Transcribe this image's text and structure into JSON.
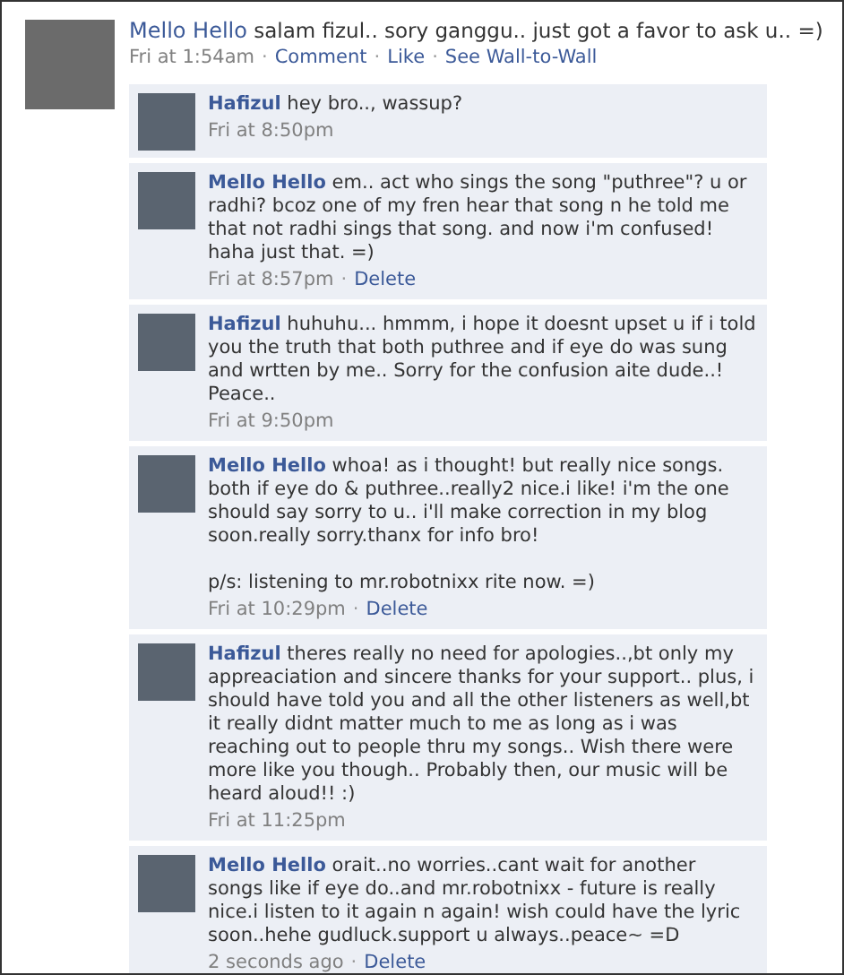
{
  "post": {
    "author": "Mello Hello",
    "text": "salam fizul.. sory ganggu.. just got a favor to ask u.. =)",
    "time": "Fri at 1:54am",
    "separator": "·",
    "actions": [
      "Comment",
      "Like",
      "See Wall-to-Wall"
    ]
  },
  "comments": [
    {
      "author": "Hafizul",
      "text": "hey bro.., wassup?",
      "time": "Fri at 8:50pm"
    },
    {
      "author": "Mello Hello",
      "text": "em.. act who sings the song \"puthree\"? u or radhi? bcoz one of my fren hear that song n he told me that not radhi sings that song. and now i'm confused! haha just that. =)",
      "time": "Fri at 8:57pm",
      "actions": [
        "Delete"
      ]
    },
    {
      "author": "Hafizul",
      "text": "huhuhu... hmmm, i hope it doesnt upset u if i told you the truth that both puthree and if eye do was sung and wrtten by me.. Sorry for the confusion aite dude..! Peace..",
      "time": "Fri at 9:50pm"
    },
    {
      "author": "Mello Hello",
      "text": "whoa! as i thought! but really nice songs. both if eye do & puthree..really2 nice.i like! i'm the one should say sorry to u.. i'll make correction in my blog soon.really sorry.thanx for info bro!\n\np/s: listening to mr.robotnixx rite now. =)",
      "time": "Fri at 10:29pm",
      "actions": [
        "Delete"
      ]
    },
    {
      "author": "Hafizul",
      "text": "theres really no need for apologies..,bt only my appreaciation and sincere thanks for your support.. plus, i should have told you and all the other listeners as well,bt it really didnt matter much to me as long as i was reaching out to people thru my songs.. Wish there were more like you though.. Probably then, our music will be heard aloud!! :)",
      "time": "Fri at 11:25pm"
    },
    {
      "author": "Mello Hello",
      "text": "orait..no worries..cant wait for another songs like if eye do..and mr.robotnixx - future is really nice.i listen to it again n again! wish could have the lyric soon..hehe gudluck.support u always..peace~ =D",
      "time": "2 seconds ago",
      "actions": [
        "Delete"
      ]
    }
  ]
}
